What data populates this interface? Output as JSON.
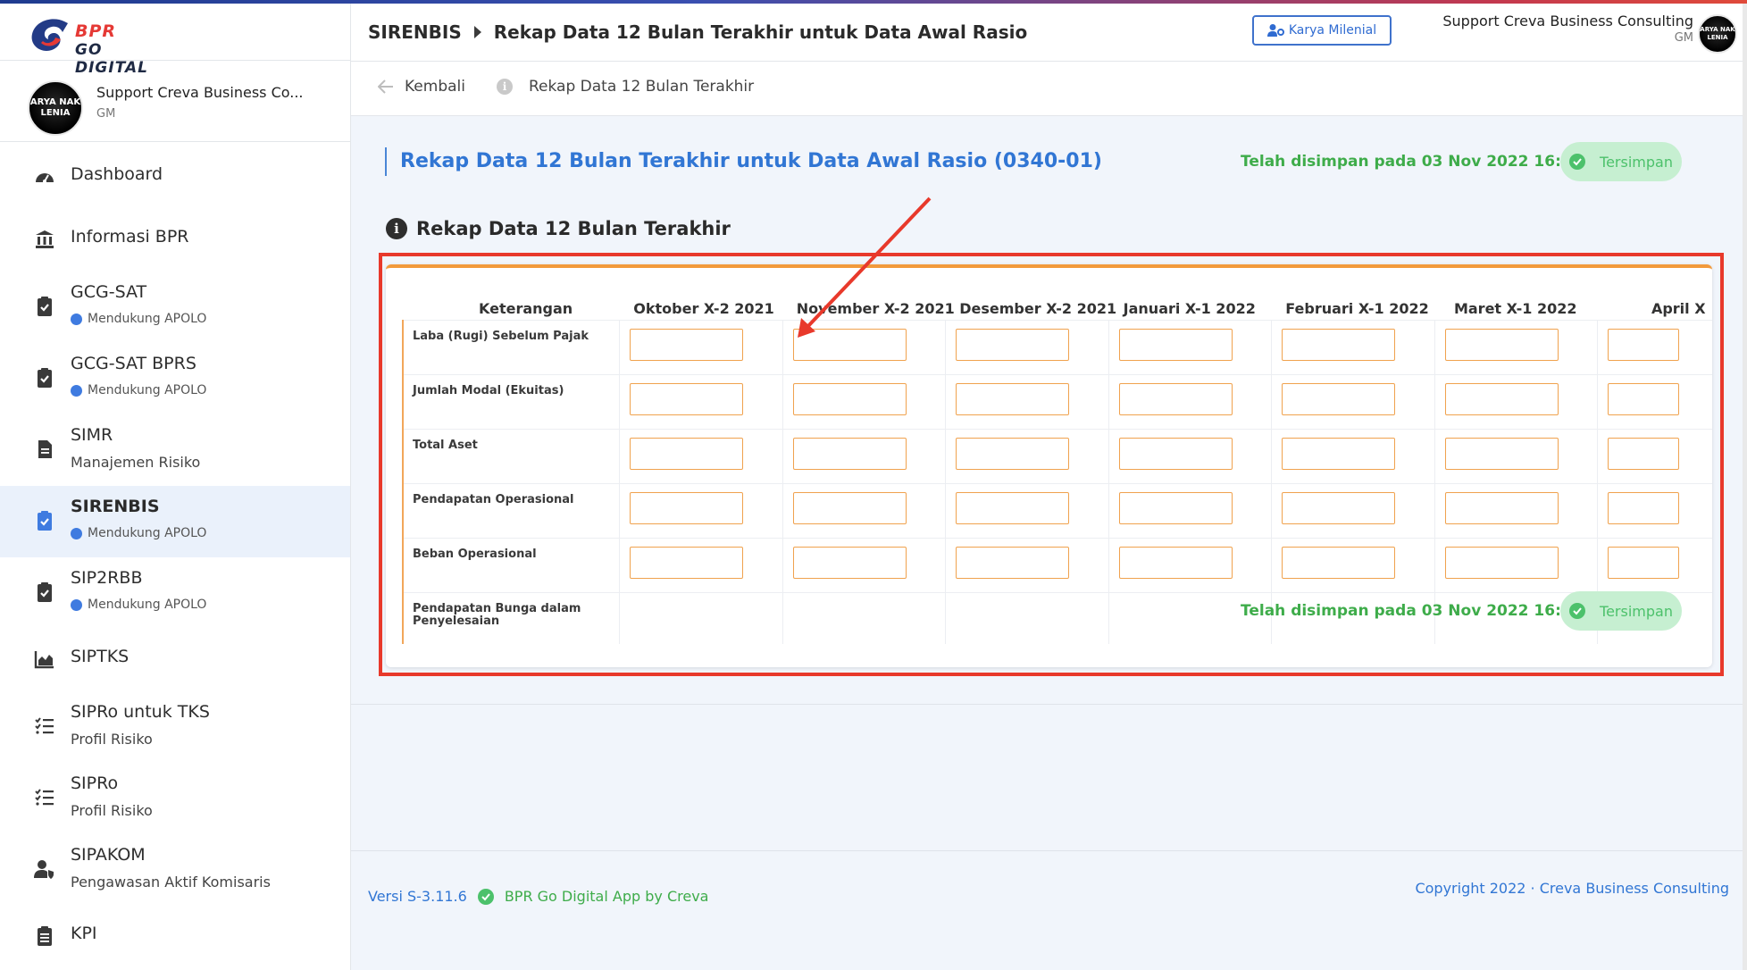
{
  "brand": {
    "line1": "BPR",
    "line2": "GO DIGITAL"
  },
  "user": {
    "name": "Support Creva Business Co...",
    "role": "GM",
    "avatar_text": "ARYA NAK LENIA"
  },
  "nav": [
    {
      "label": "Dashboard",
      "icon": "dashboard-icon"
    },
    {
      "label": "Informasi BPR",
      "icon": "bank-icon"
    },
    {
      "label": "GCG-SAT",
      "sub": "Mendukung APOLO",
      "icon": "clipboard-check-icon"
    },
    {
      "label": "GCG-SAT BPRS",
      "sub": "Mendukung APOLO",
      "icon": "clipboard-check-icon"
    },
    {
      "label": "SIMR",
      "sub2": "Manajemen Risiko",
      "icon": "document-icon"
    },
    {
      "label": "SIRENBIS",
      "sub": "Mendukung APOLO",
      "icon": "clipboard-check-icon",
      "active": true
    },
    {
      "label": "SIP2RBB",
      "sub": "Mendukung APOLO",
      "icon": "clipboard-check-icon"
    },
    {
      "label": "SIPTKS",
      "icon": "area-chart-icon"
    },
    {
      "label": "SIPRo untuk TKS",
      "sub2": "Profil Risiko",
      "icon": "checklist-icon"
    },
    {
      "label": "SIPRo",
      "sub2": "Profil Risiko",
      "icon": "checklist-icon"
    },
    {
      "label": "SIPAKOM",
      "sub2": "Pengawasan Aktif Komisaris",
      "icon": "user-shield-icon"
    },
    {
      "label": "KPI",
      "icon": "clipboard-list-icon"
    }
  ],
  "header": {
    "breadcrumb_root": "SIRENBIS",
    "breadcrumb_page": "Rekap Data 12 Bulan Terakhir untuk Data Awal Rasio",
    "karya_button": "Karya Milenial",
    "user_name": "Support Creva Business Consulting",
    "user_role": "GM"
  },
  "subbar": {
    "back": "Kembali",
    "info": "Rekap Data 12 Bulan Terakhir"
  },
  "main": {
    "title": "Rekap Data 12 Bulan Terakhir untuk Data Awal Rasio (0340-01)",
    "saved_text": "Telah disimpan pada 03 Nov 2022 16:44",
    "saved_button": "Tersimpan",
    "section_title": "Rekap Data 12 Bulan Terakhir",
    "colors": {
      "accent": "#3176d4",
      "success": "#3eac4a",
      "input_border": "#f0a24e",
      "highlight": "#e8392b"
    }
  },
  "table": {
    "header_label": "Keterangan",
    "columns": [
      "Oktober X-2 2021",
      "November X-2 2021",
      "Desember X-2 2021",
      "Januari X-1 2022",
      "Februari X-1 2022",
      "Maret X-1 2022",
      "April X"
    ],
    "rows": [
      {
        "label": "Laba (Rugi) Sebelum Pajak",
        "has_inputs": true
      },
      {
        "label": "Jumlah Modal (Ekuitas)",
        "has_inputs": true
      },
      {
        "label": "Total Aset",
        "has_inputs": true
      },
      {
        "label": "Pendapatan Operasional",
        "has_inputs": true
      },
      {
        "label": "Beban Operasional",
        "has_inputs": true
      },
      {
        "label": "Pendapatan Bunga dalam Penyelesaian",
        "has_inputs": false
      }
    ]
  },
  "footer": {
    "version": "Versi S-3.11.6",
    "app": "BPR Go Digital App by Creva",
    "copyright": "Copyright 2022 · Creva Business Consulting"
  }
}
